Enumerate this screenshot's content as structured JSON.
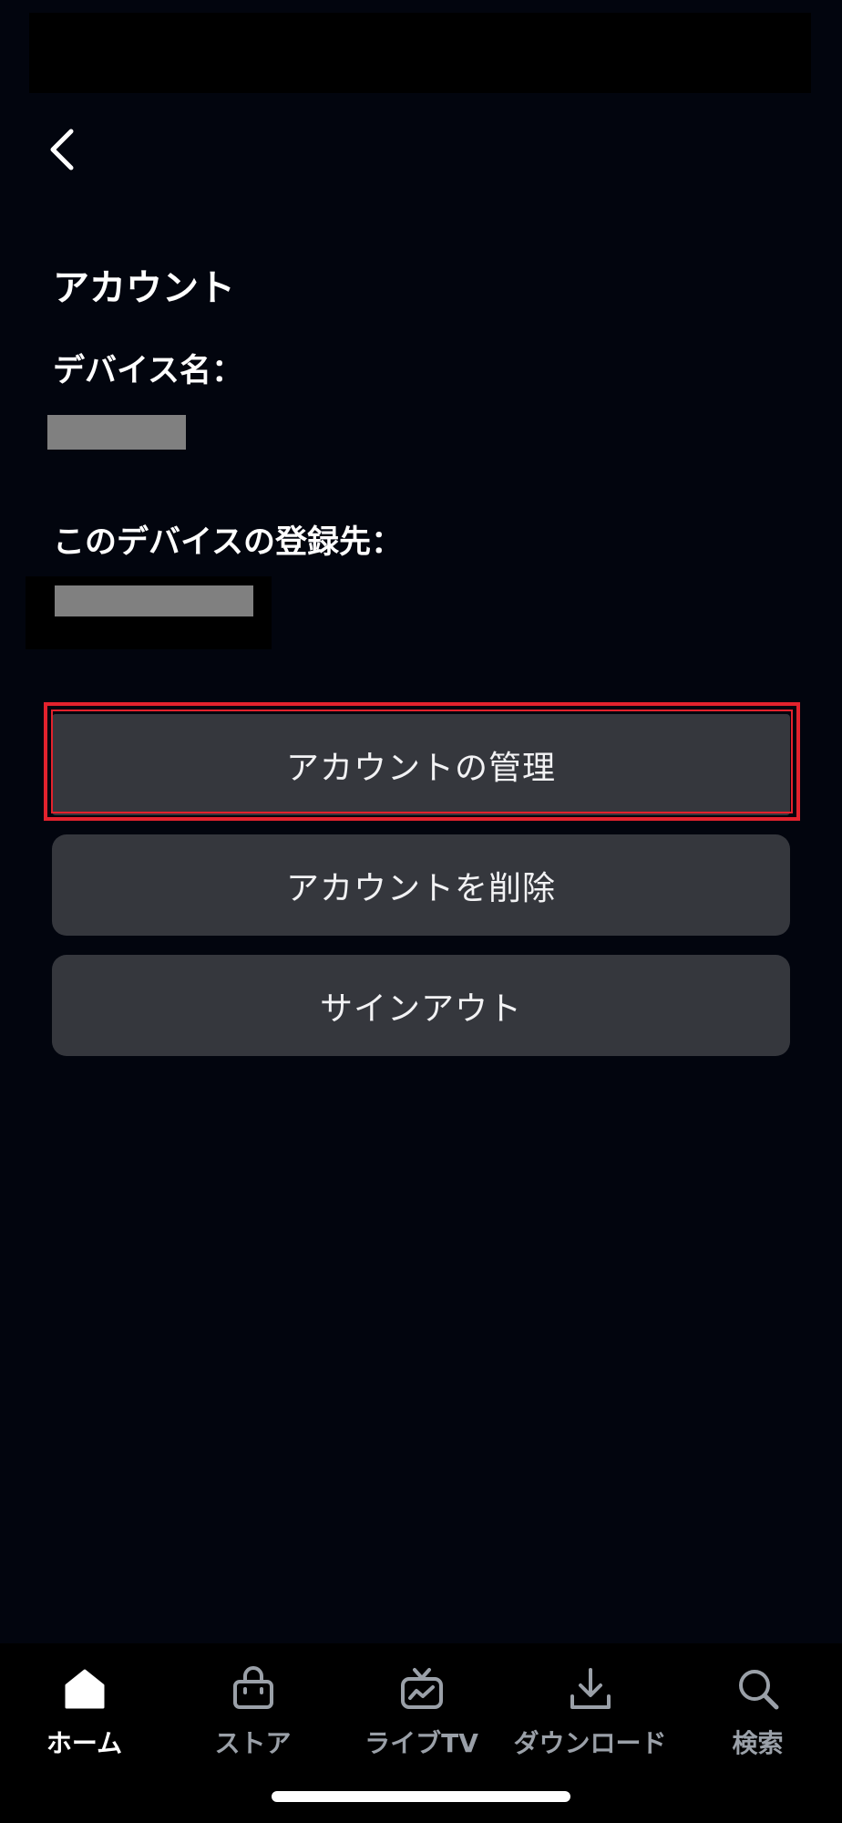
{
  "header": {
    "back_icon": "chevron-left-icon"
  },
  "account": {
    "title": "アカウント",
    "device_name_label": "デバイス名：",
    "registered_to_label": "このデバイスの登録先："
  },
  "buttons": {
    "manage_account": "アカウントの管理",
    "delete_account": "アカウントを削除",
    "sign_out": "サインアウト"
  },
  "highlight_color": "#e3222d",
  "bottom_nav": {
    "items": [
      {
        "label": "ホーム",
        "icon": "home-icon",
        "active": true
      },
      {
        "label": "ストア",
        "icon": "shopping-bag-icon",
        "active": false
      },
      {
        "label": "ライブTV",
        "icon": "live-tv-icon",
        "active": false
      },
      {
        "label": "ダウンロード",
        "icon": "download-icon",
        "active": false
      },
      {
        "label": "検索",
        "icon": "search-icon",
        "active": false
      }
    ]
  }
}
